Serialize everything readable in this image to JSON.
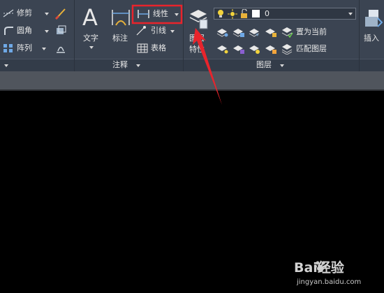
{
  "ribbon": {
    "modify": {
      "trim_label": "修剪",
      "fillet_label": "圆角",
      "array_label": "阵列"
    },
    "annotation": {
      "text_label": "文字",
      "dimension_label": "标注",
      "linear_label": "线性",
      "leader_label": "引线",
      "table_label": "表格",
      "panel_title": "注释"
    },
    "layers": {
      "properties_label_1": "图层",
      "properties_label_2": "特性",
      "current_layer": "0",
      "set_current_label": "置为当前",
      "match_layer_label": "匹配图层",
      "panel_title": "图层"
    },
    "block": {
      "insert_label": "插入"
    }
  },
  "annotation_overlay": {
    "highlight_color": "#e8242c",
    "arrow_color": "#e8242c"
  },
  "watermark": {
    "brand_text": "Bai经验",
    "url_text": "jingyan.baidu.com"
  }
}
